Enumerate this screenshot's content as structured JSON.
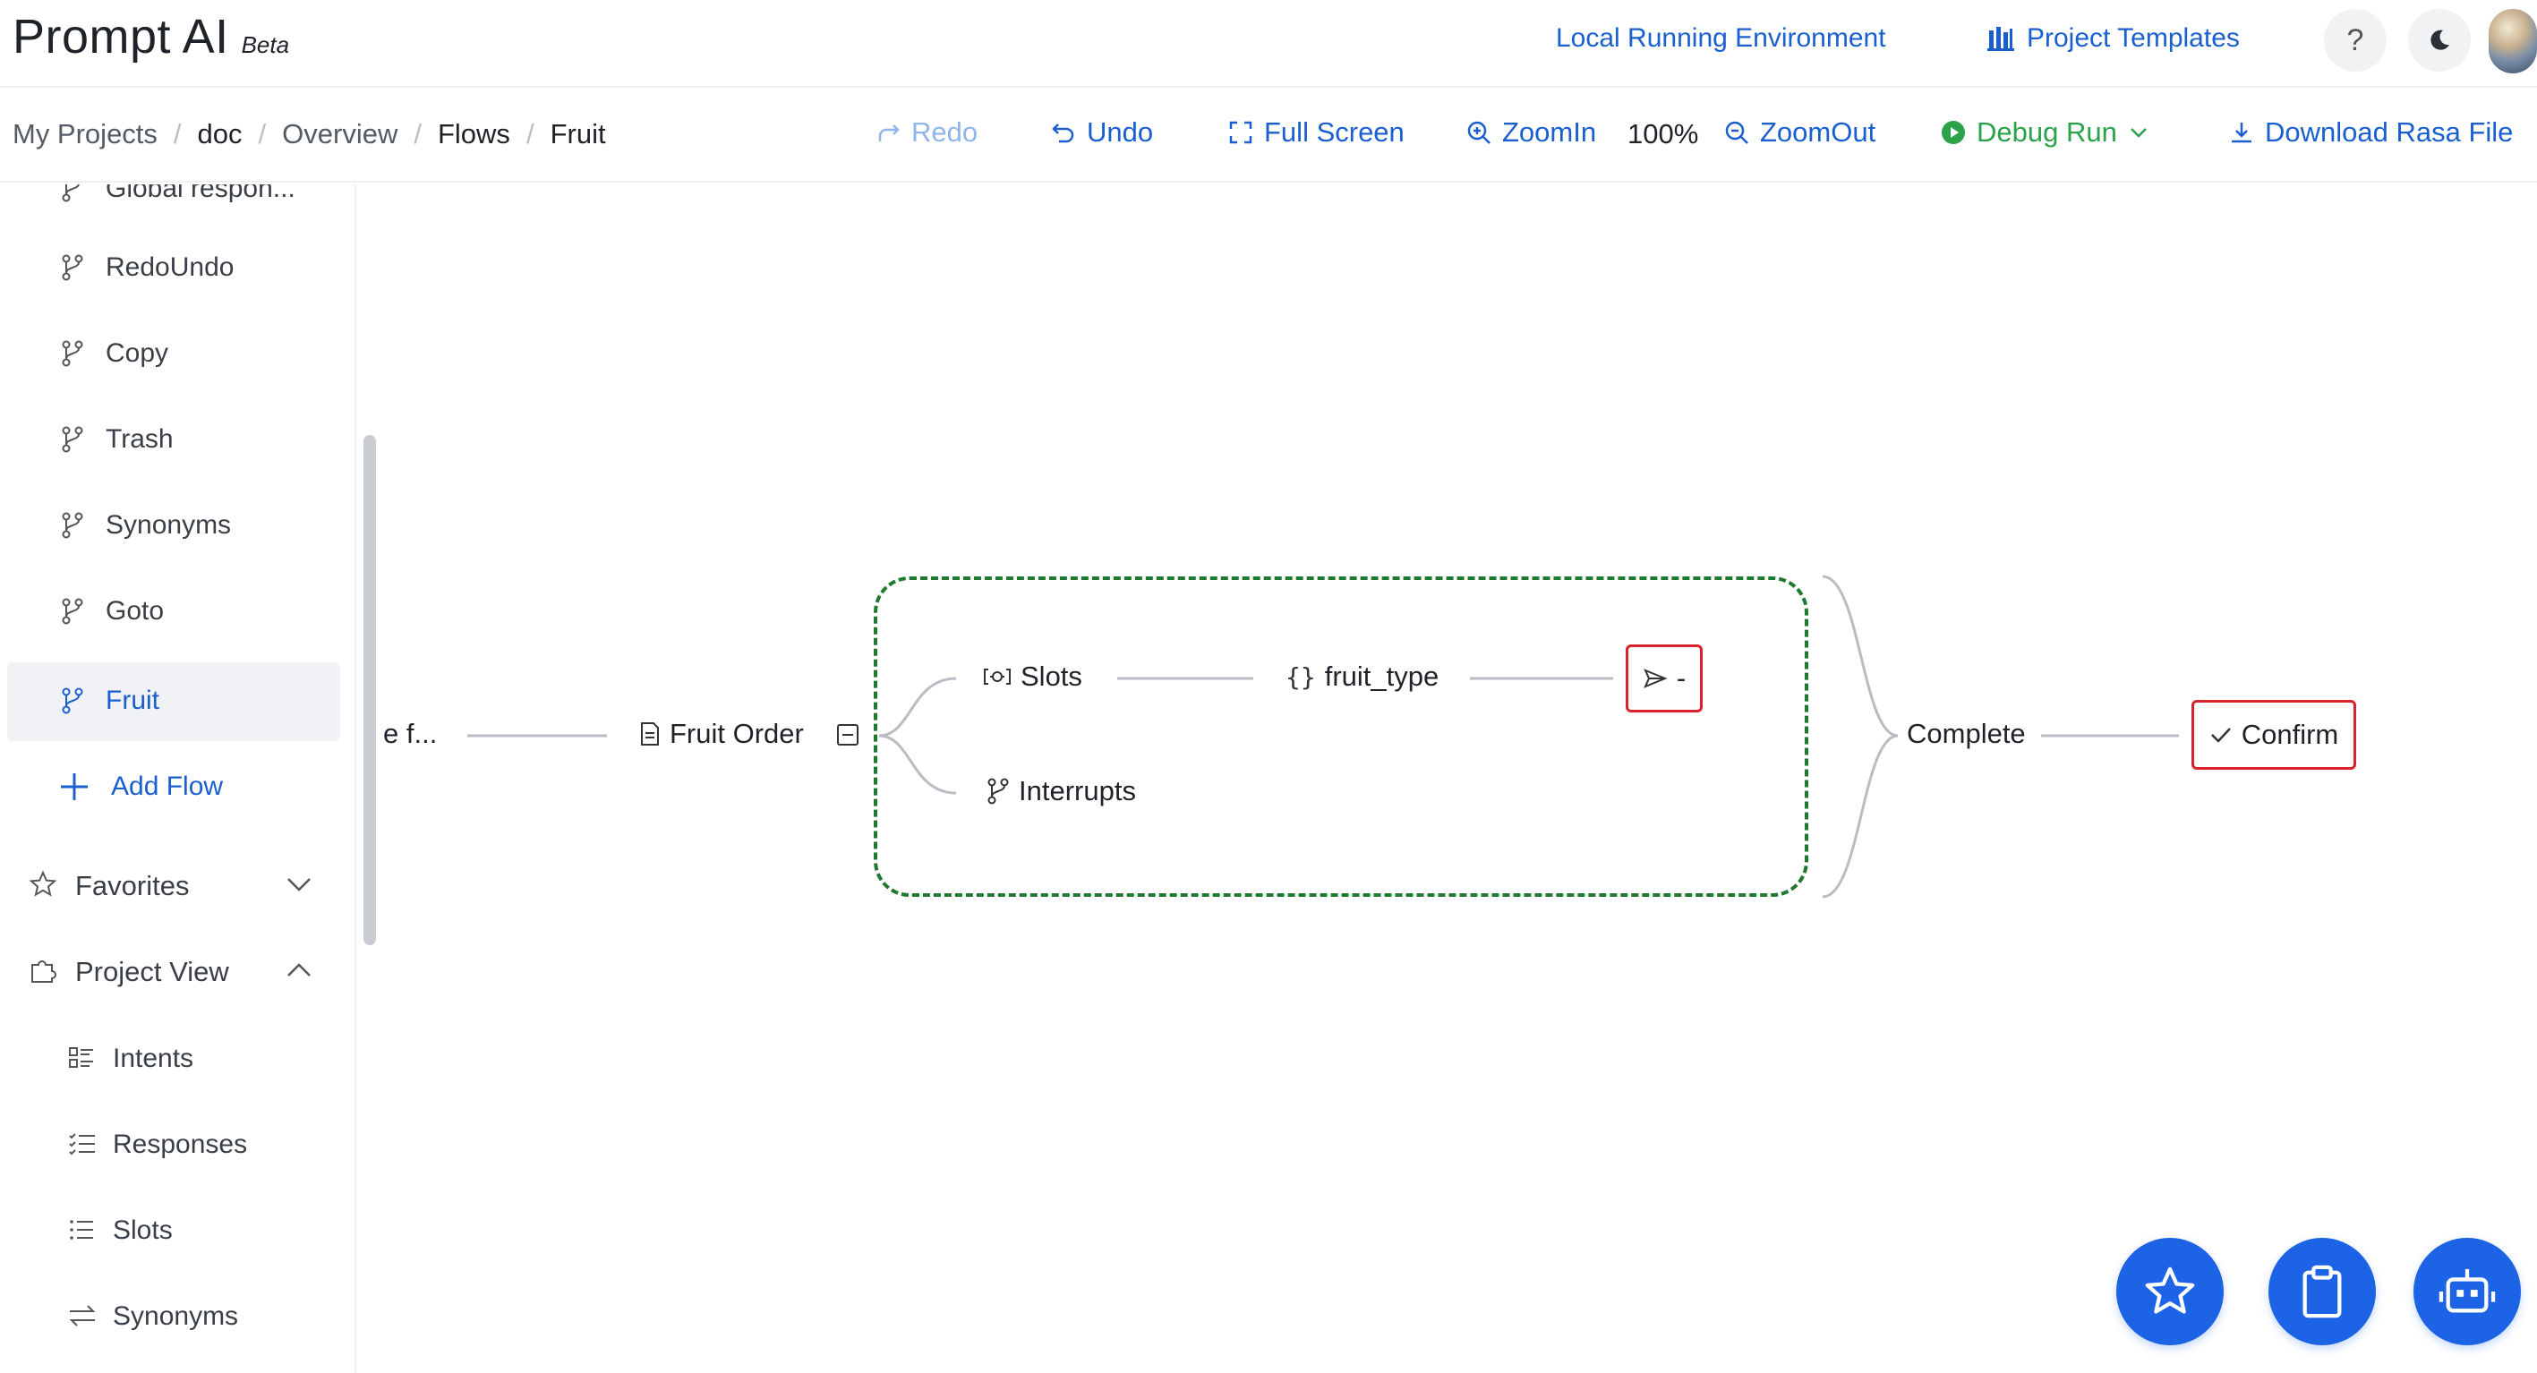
{
  "app": {
    "title": "Prompt AI",
    "badge": "Beta"
  },
  "header": {
    "env_link": "Local Running Environment",
    "templates_link": "Project Templates",
    "help_icon": "question-icon",
    "theme_icon": "moon-icon"
  },
  "breadcrumb": [
    "My Projects",
    "doc",
    "Overview",
    "Flows",
    "Fruit"
  ],
  "toolbar": {
    "redo": "Redo",
    "undo": "Undo",
    "fullscreen": "Full Screen",
    "zoom_in": "ZoomIn",
    "zoom_level": "100%",
    "zoom_out": "ZoomOut",
    "debug_run": "Debug Run",
    "download": "Download Rasa File"
  },
  "sidebar": {
    "flows": [
      {
        "label": "Global respon...",
        "icon": "branch-icon"
      },
      {
        "label": "RedoUndo",
        "icon": "branch-icon"
      },
      {
        "label": "Copy",
        "icon": "branch-icon"
      },
      {
        "label": "Trash",
        "icon": "branch-icon"
      },
      {
        "label": "Synonyms",
        "icon": "branch-icon"
      },
      {
        "label": "Goto",
        "icon": "branch-icon"
      },
      {
        "label": "Fruit",
        "icon": "branch-icon",
        "active": true
      }
    ],
    "add_flow": "Add Flow",
    "favorites": "Favorites",
    "project_view": "Project View",
    "project_items": [
      {
        "label": "Intents",
        "icon": "intents-icon"
      },
      {
        "label": "Responses",
        "icon": "responses-icon"
      },
      {
        "label": "Slots",
        "icon": "list-icon"
      },
      {
        "label": "Synonyms",
        "icon": "swap-icon"
      }
    ]
  },
  "flow": {
    "trigger_label": "e f...",
    "fruit_order": "Fruit Order",
    "slots": "Slots",
    "slot_name": "fruit_type",
    "send_label": "-",
    "interrupts": "Interrupts",
    "complete": "Complete",
    "confirm": "Confirm"
  },
  "fabs": [
    "star-icon",
    "clipboard-icon",
    "robot-icon"
  ],
  "colors": {
    "accent": "#1a5fd0",
    "fab": "#1c63e6",
    "debug": "#2aa24a",
    "group_border": "#1f7a2f",
    "highlight_border": "#d9232d"
  }
}
